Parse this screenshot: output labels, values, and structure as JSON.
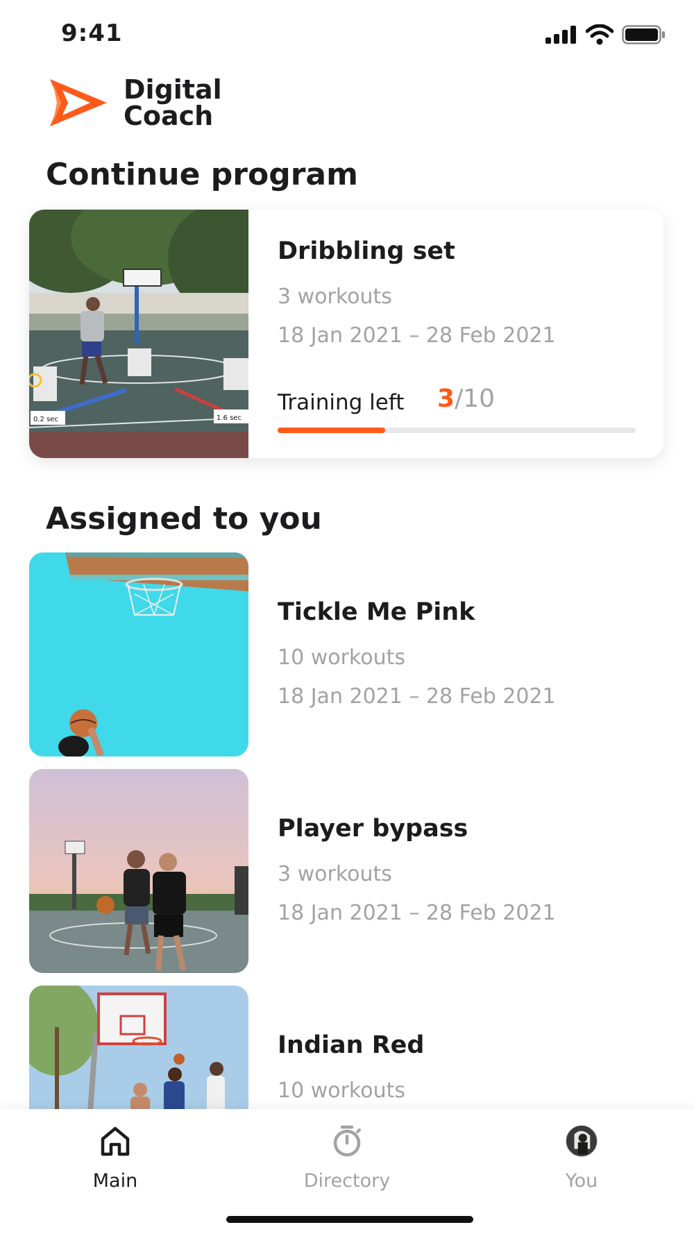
{
  "status_bar": {
    "time": "9:41",
    "icons": [
      "signal-icon",
      "wifi-icon",
      "battery-icon"
    ]
  },
  "brand": {
    "line1": "Digital",
    "line2": "Coach",
    "accent": "#ff5a1a"
  },
  "continue_section": {
    "title": "Continue program",
    "program": {
      "title": "Dribbling set",
      "workouts": "3 workouts",
      "dates": "18 Jan 2021 – 28 Feb 2021",
      "training_left_label": "Training left",
      "current": "3",
      "total": "/10",
      "progress": 0.3,
      "image_labels": [
        "0.2 sec",
        "1.6 sec"
      ]
    }
  },
  "assigned_section": {
    "title": "Assigned to you",
    "items": [
      {
        "title": "Tickle Me Pink",
        "workouts": "10 workouts",
        "dates": "18 Jan 2021 – 28 Feb 2021"
      },
      {
        "title": "Player bypass",
        "workouts": "3 workouts",
        "dates": "18 Jan 2021 – 28 Feb 2021"
      },
      {
        "title": "Indian Red",
        "workouts": "10 workouts"
      }
    ]
  },
  "tab_bar": {
    "tabs": [
      {
        "label": "Main",
        "icon": "home-icon",
        "active": true
      },
      {
        "label": "Directory",
        "icon": "stopwatch-icon",
        "active": false
      },
      {
        "label": "You",
        "icon": "avatar",
        "active": false
      }
    ],
    "colors": {
      "active": "#1c1c1e",
      "inactive": "#a2a2a6"
    }
  }
}
